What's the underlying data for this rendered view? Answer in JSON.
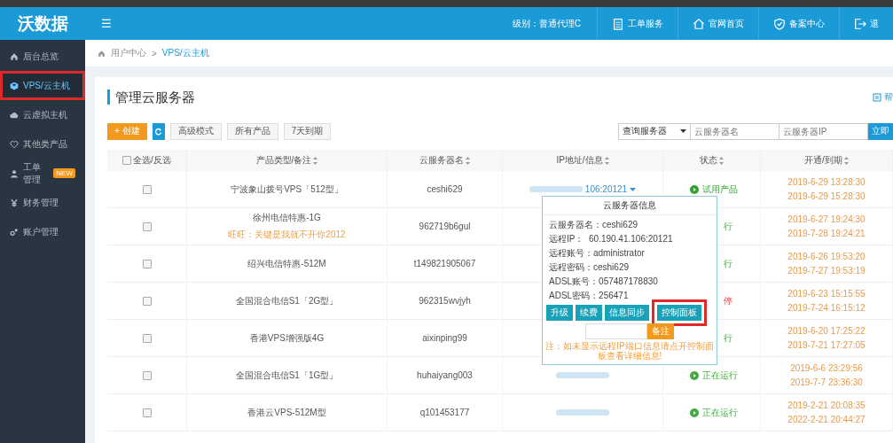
{
  "header": {
    "logo": "沃数据",
    "menu_icon": "☰",
    "level": "级别：普通代理C",
    "links": [
      {
        "label": "工单服务"
      },
      {
        "label": "官网首页"
      },
      {
        "label": "备案中心"
      },
      {
        "label": "退"
      }
    ]
  },
  "sidebar": {
    "items": [
      {
        "label": "后台总览",
        "selected": false
      },
      {
        "label": "VPS/云主机",
        "selected": true
      },
      {
        "label": "云虚拟主机",
        "selected": false
      },
      {
        "label": "其他类产品",
        "selected": false
      },
      {
        "label": "工单管理",
        "selected": false,
        "badge": "NEW"
      },
      {
        "label": "财务管理",
        "selected": false
      },
      {
        "label": "账户管理",
        "selected": false
      }
    ]
  },
  "breadcrumb": [
    "用户中心",
    "VPS/云主机"
  ],
  "breadcrumb_separator": ">",
  "panel": {
    "title": "管理云服务器",
    "help": "帮",
    "toolbar": {
      "create": "+ 创建",
      "filters": [
        "高级模式",
        "所有产品",
        "7天到期"
      ],
      "search_type": "查询服务器",
      "name_placeholder": "云服务器名",
      "ip_placeholder": "云服务器IP",
      "search_button": "立即"
    }
  },
  "table": {
    "select_all": "全选/反选",
    "select_all_checked": false,
    "columns": [
      "产品类型/备注",
      "云服务器名",
      "IP地址/信息",
      "状态",
      "开通/到期"
    ],
    "rows": [
      {
        "checked": false,
        "product": "宁波象山拨号VPS「512型」",
        "name": "ceshi629",
        "ip": "106:20121",
        "status": {
          "kind": "trial",
          "text": "试用产品",
          "icon": true
        },
        "opened": "2019-6-29 13:28:30",
        "expires": "2019-6-29 15:28:30"
      },
      {
        "checked": false,
        "product": "徐州电信特惠-1G",
        "note": "旺旺：关键是我就不开你2012",
        "name": "962719b6gul",
        "status": {
          "kind": "running",
          "text": "行",
          "icon": false
        },
        "opened": "2019-6-27 19:24:30",
        "expires": "2019-7-28 19:24:21"
      },
      {
        "checked": false,
        "product": "绍兴电信特惠-512M",
        "name": "t149821905067",
        "status": {
          "kind": "running",
          "text": "行",
          "icon": false
        },
        "opened": "2019-6-26 19:53:20",
        "expires": "2019-7-27 19:53:19"
      },
      {
        "checked": false,
        "product": "全国混合电信S1「2G型」",
        "name": "962315wvjyh",
        "status": {
          "kind": "stopped",
          "text": "停",
          "icon": false
        },
        "opened": "2019-6-23 15:15:55",
        "expires": "2019-7-24 16:15:12"
      },
      {
        "checked": false,
        "product": "香港VPS增强版4G",
        "name": "aixinping99",
        "status": {
          "kind": "running",
          "text": "行",
          "icon": false
        },
        "opened": "2019-6-20 17:25:22",
        "expires": "2019-7-21 17:27:05"
      },
      {
        "checked": false,
        "product": "全国混合电信S1「1G型」",
        "name": "huhaiyang003",
        "status": {
          "kind": "running",
          "text": "正在运行",
          "icon": true
        },
        "opened": "2019-6-6 23:29:56",
        "expires": "2019-7-7 23:36:30"
      },
      {
        "checked": false,
        "product": "香港云VPS-512M型",
        "name": "q101453177",
        "status": {
          "kind": "running",
          "text": "正在运行",
          "icon": true
        },
        "opened": "2019-2-21 20:08:35",
        "expires": "2022-2-21 20:44:27"
      }
    ]
  },
  "popup": {
    "title": "云服务器信息",
    "lines": [
      "云服务器名：ceshi629",
      "远程IP：  60.190.41.106:20121",
      "远程账号：administrator",
      "远程密码：ceshi629",
      "ADSL账号：057487178830",
      "ADSL密码：256471"
    ],
    "buttons": [
      {
        "label": "升级",
        "highlighted": false
      },
      {
        "label": "续费",
        "highlighted": false
      },
      {
        "label": "信息同步",
        "highlighted": false
      },
      {
        "label": "控制面板",
        "highlighted": true
      }
    ],
    "remark_button": "备注",
    "note": "注：如未显示远程IP端口信息请点开控制面板查看详细信息!"
  }
}
